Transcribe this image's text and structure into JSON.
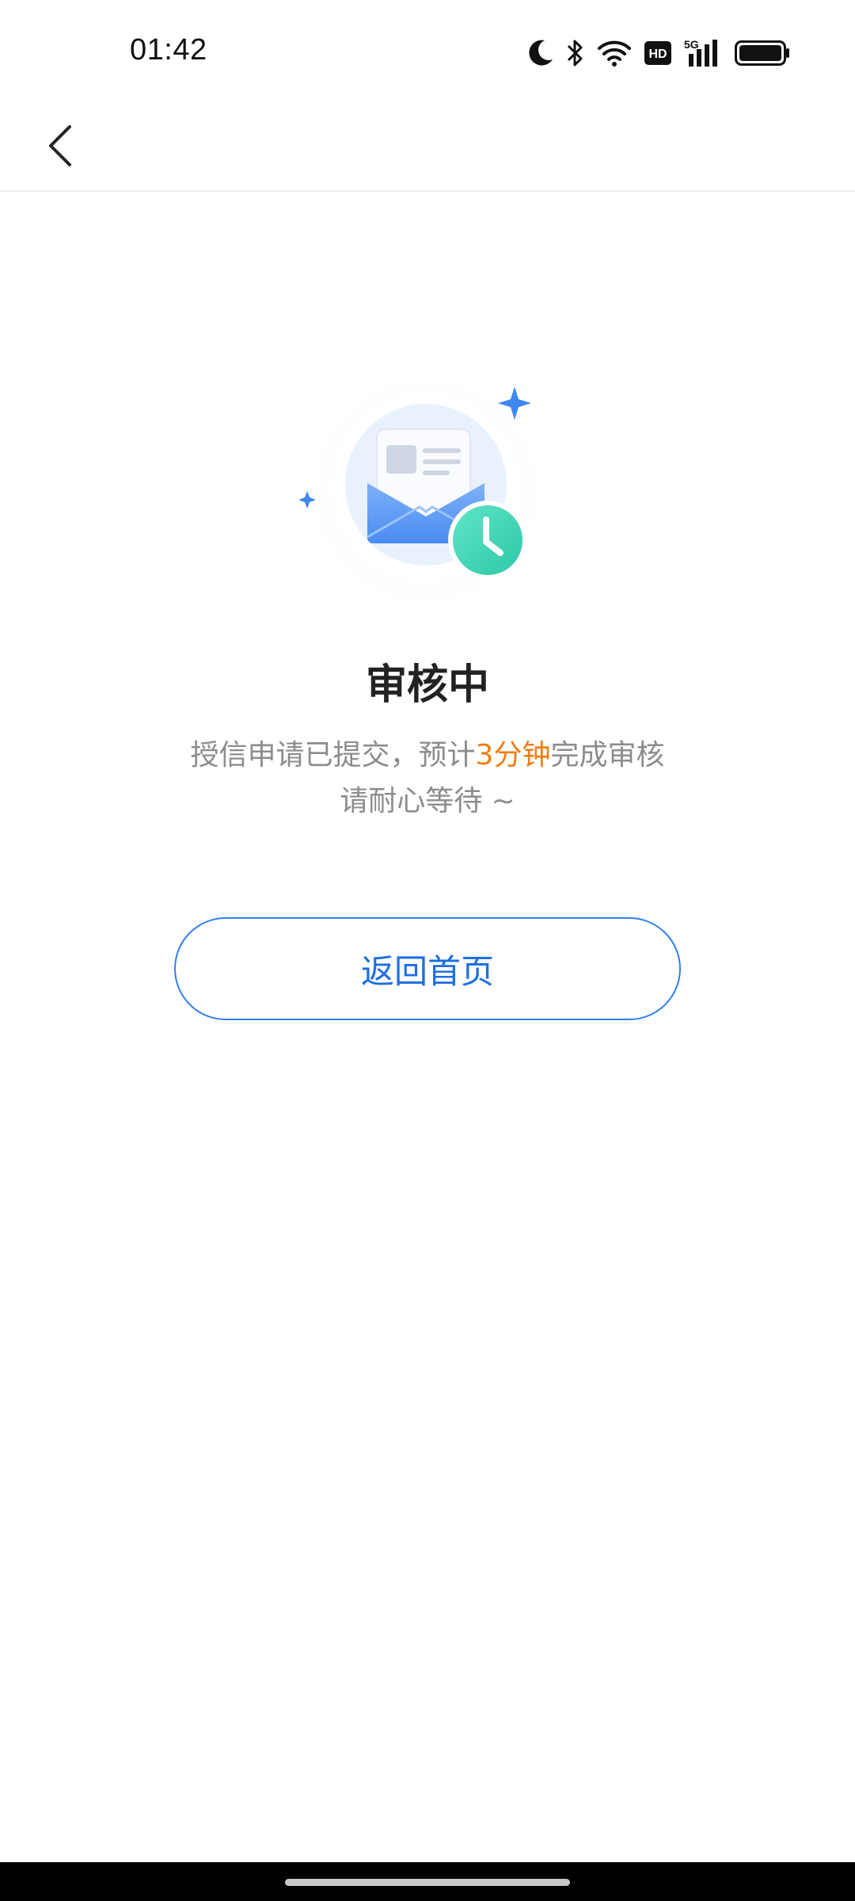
{
  "status_bar": {
    "time": "01:42",
    "icons": [
      "moon-icon",
      "bluetooth-icon",
      "wifi-icon",
      "hd-icon",
      "5g-signal-icon",
      "battery-icon"
    ],
    "hd_label": "HD",
    "network_label": "5G"
  },
  "nav": {
    "back_icon": "chevron-left-icon"
  },
  "illustration": {
    "icon": "envelope-clock-icon",
    "accent_blue": "#4a8cf0",
    "clock_green": "#3fd6b8"
  },
  "review": {
    "title": "审核中",
    "line1_prefix": "授信申请已提交，预计",
    "line1_highlight": "3分钟",
    "line1_suffix": "完成审核",
    "line2": "请耐心等待 ~",
    "highlight_color": "#ef7d14"
  },
  "actions": {
    "home_label": "返回首页"
  }
}
